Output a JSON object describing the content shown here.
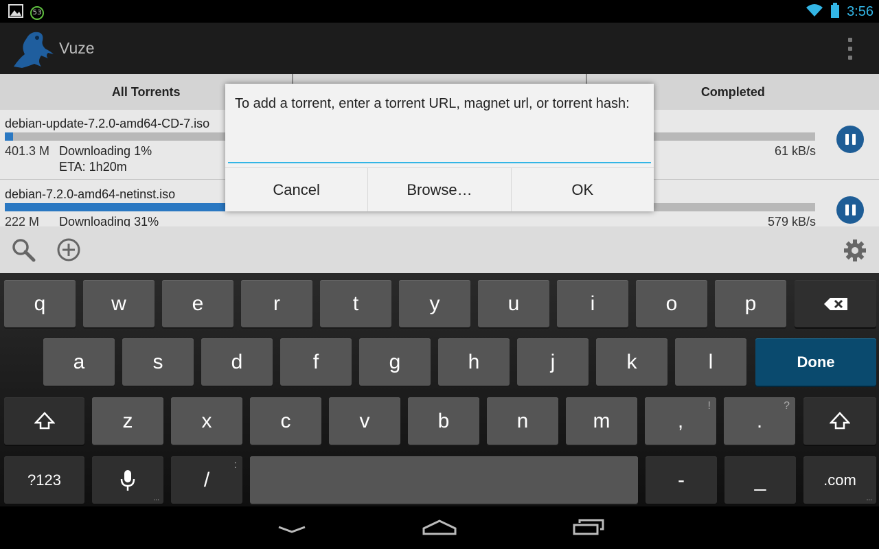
{
  "status_bar": {
    "time": "3:56",
    "notification_badge": "53",
    "icons": [
      "image-notification-icon",
      "sync-badge-icon",
      "wifi-icon",
      "battery-icon"
    ]
  },
  "app": {
    "title": "Vuze",
    "logo": "vuze-frog-logo"
  },
  "tabs": [
    {
      "label": "All Torrents"
    },
    {
      "label": ""
    },
    {
      "label": "Completed"
    }
  ],
  "torrents": [
    {
      "name": "debian-update-7.2.0-amd64-CD-7.iso",
      "size": "401.3 M",
      "status": "Downloading 1%",
      "eta": "ETA: 1h20m",
      "speed": "61 kB/s",
      "progress": 0.01
    },
    {
      "name": "debian-7.2.0-amd64-netinst.iso",
      "size": "222 M",
      "status": "Downloading 31%",
      "eta": "",
      "speed": "579 kB/s",
      "progress": 0.31
    }
  ],
  "bottom_bar": {
    "icons": [
      "search-icon",
      "add-circle-icon",
      "settings-gear-icon"
    ]
  },
  "dialog": {
    "message": "To add a torrent, enter a torrent URL, magnet url, or torrent hash:",
    "input_value": "",
    "cancel_label": "Cancel",
    "browse_label": "Browse…",
    "ok_label": "OK"
  },
  "keyboard": {
    "row1": [
      "q",
      "w",
      "e",
      "r",
      "t",
      "y",
      "u",
      "i",
      "o",
      "p"
    ],
    "row2": [
      "a",
      "s",
      "d",
      "f",
      "g",
      "h",
      "j",
      "k",
      "l"
    ],
    "row3": [
      "z",
      "x",
      "c",
      "v",
      "b",
      "n",
      "m",
      ",",
      "."
    ],
    "row3_hints": [
      "",
      "",
      "",
      "",
      "",
      "",
      "",
      "!",
      "?"
    ],
    "done_label": "Done",
    "symbols_label": "?123",
    "slash_label": "/",
    "slash_hint": ":",
    "dash_label": "-",
    "underscore_label": "_",
    "dotcom_label": ".com"
  },
  "colors": {
    "accent": "#33b5e5",
    "action_key": "#0a4a6e",
    "progress": "#2a78c2",
    "pause_button": "#1e5d96"
  }
}
